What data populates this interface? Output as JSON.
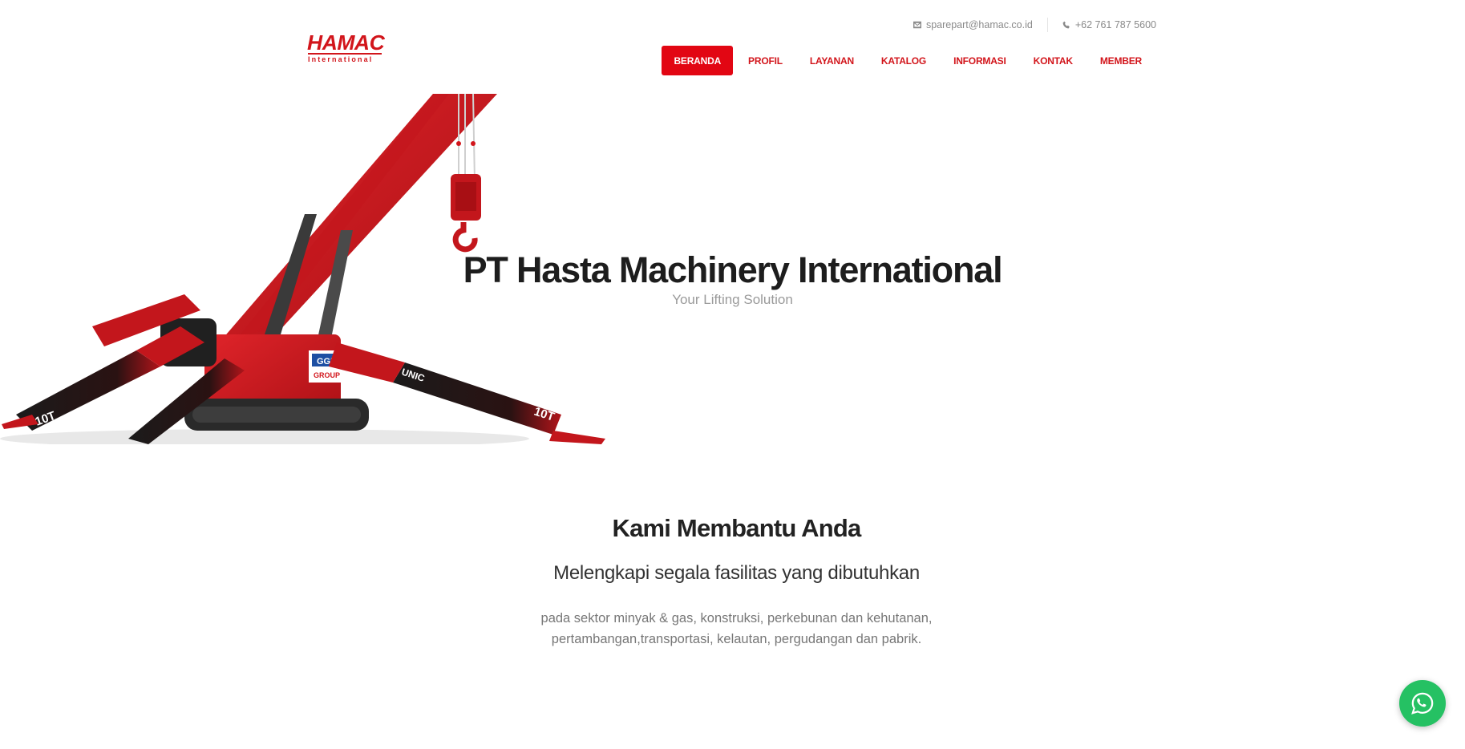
{
  "brand": {
    "logo_text": "HAMAC",
    "logo_subtext": "International"
  },
  "topbar": {
    "email_icon": "envelope-icon",
    "email": "sparepart@hamac.co.id",
    "phone_icon": "phone-icon",
    "phone": "+62 761 787 5600"
  },
  "nav": {
    "items": [
      {
        "label": "BERANDA",
        "active": true
      },
      {
        "label": "PROFIL",
        "active": false
      },
      {
        "label": "LAYANAN",
        "active": false
      },
      {
        "label": "KATALOG",
        "active": false
      },
      {
        "label": "INFORMASI",
        "active": false
      },
      {
        "label": "KONTAK",
        "active": false
      },
      {
        "label": "MEMBER",
        "active": false
      }
    ]
  },
  "hero": {
    "title": "PT Hasta Machinery International",
    "subtitle": "Your Lifting Solution",
    "image_text": {
      "boom": "UNIC",
      "badge_top": "GGR",
      "badge_bottom": "GROUP",
      "weight": "10T"
    }
  },
  "section": {
    "title": "Kami Membantu Anda",
    "subtitle": "Melengkapi segala fasilitas yang dibutuhkan",
    "body_line1": "pada sektor minyak & gas, konstruksi, perkebunan dan kehutanan,",
    "body_line2": "pertambangan,transportasi, kelautan, pergudangan dan pabrik."
  },
  "whatsapp": {
    "icon": "whatsapp-icon"
  },
  "colors": {
    "brand_red": "#d2151b",
    "active_nav_bg": "#e20613",
    "whatsapp_green": "#25c163"
  }
}
